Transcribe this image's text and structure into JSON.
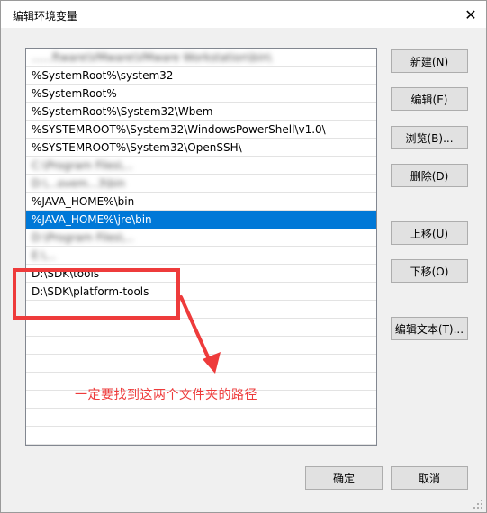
{
  "window": {
    "title": "编辑环境变量",
    "close_glyph": "✕"
  },
  "paths": [
    {
      "text": "......ftware\\VMware\\VMware Workstation\\bin\\",
      "blur": true
    },
    {
      "text": "%SystemRoot%\\system32",
      "blur": false
    },
    {
      "text": "%SystemRoot%",
      "blur": false
    },
    {
      "text": "%SystemRoot%\\System32\\Wbem",
      "blur": false
    },
    {
      "text": "%SYSTEMROOT%\\System32\\WindowsPowerShell\\v1.0\\",
      "blur": false
    },
    {
      "text": "%SYSTEMROOT%\\System32\\OpenSSH\\",
      "blur": false
    },
    {
      "text": "C:\\Program Files\\...",
      "blur": true
    },
    {
      "text": "D:\\...ovem...3\\bin",
      "blur": true
    },
    {
      "text": "%JAVA_HOME%\\bin",
      "blur": false
    },
    {
      "text": "%JAVA_HOME%\\jre\\bin",
      "blur": false,
      "selected": true
    },
    {
      "text": "D:\\Program Files\\...",
      "blur": true
    },
    {
      "text": "E:\\...",
      "blur": true
    },
    {
      "text": "D:\\SDK\\tools",
      "blur": false
    },
    {
      "text": "D:\\SDK\\platform-tools",
      "blur": false
    },
    {
      "text": "",
      "blur": false
    },
    {
      "text": "",
      "blur": false
    },
    {
      "text": "",
      "blur": false
    },
    {
      "text": "",
      "blur": false
    },
    {
      "text": "",
      "blur": false
    },
    {
      "text": "",
      "blur": false
    },
    {
      "text": "",
      "blur": false
    },
    {
      "text": "",
      "blur": false
    }
  ],
  "buttons": {
    "new": "新建(N)",
    "edit": "编辑(E)",
    "browse": "浏览(B)...",
    "delete": "删除(D)",
    "move_up": "上移(U)",
    "move_down": "下移(O)",
    "edit_text": "编辑文本(T)...",
    "ok": "确定",
    "cancel": "取消"
  },
  "annotation": {
    "text": "一定要找到这两个文件夹的路径",
    "color": "#ee3b3b"
  },
  "colors": {
    "selection": "#0078d7",
    "annotation": "#ee3b3b"
  }
}
